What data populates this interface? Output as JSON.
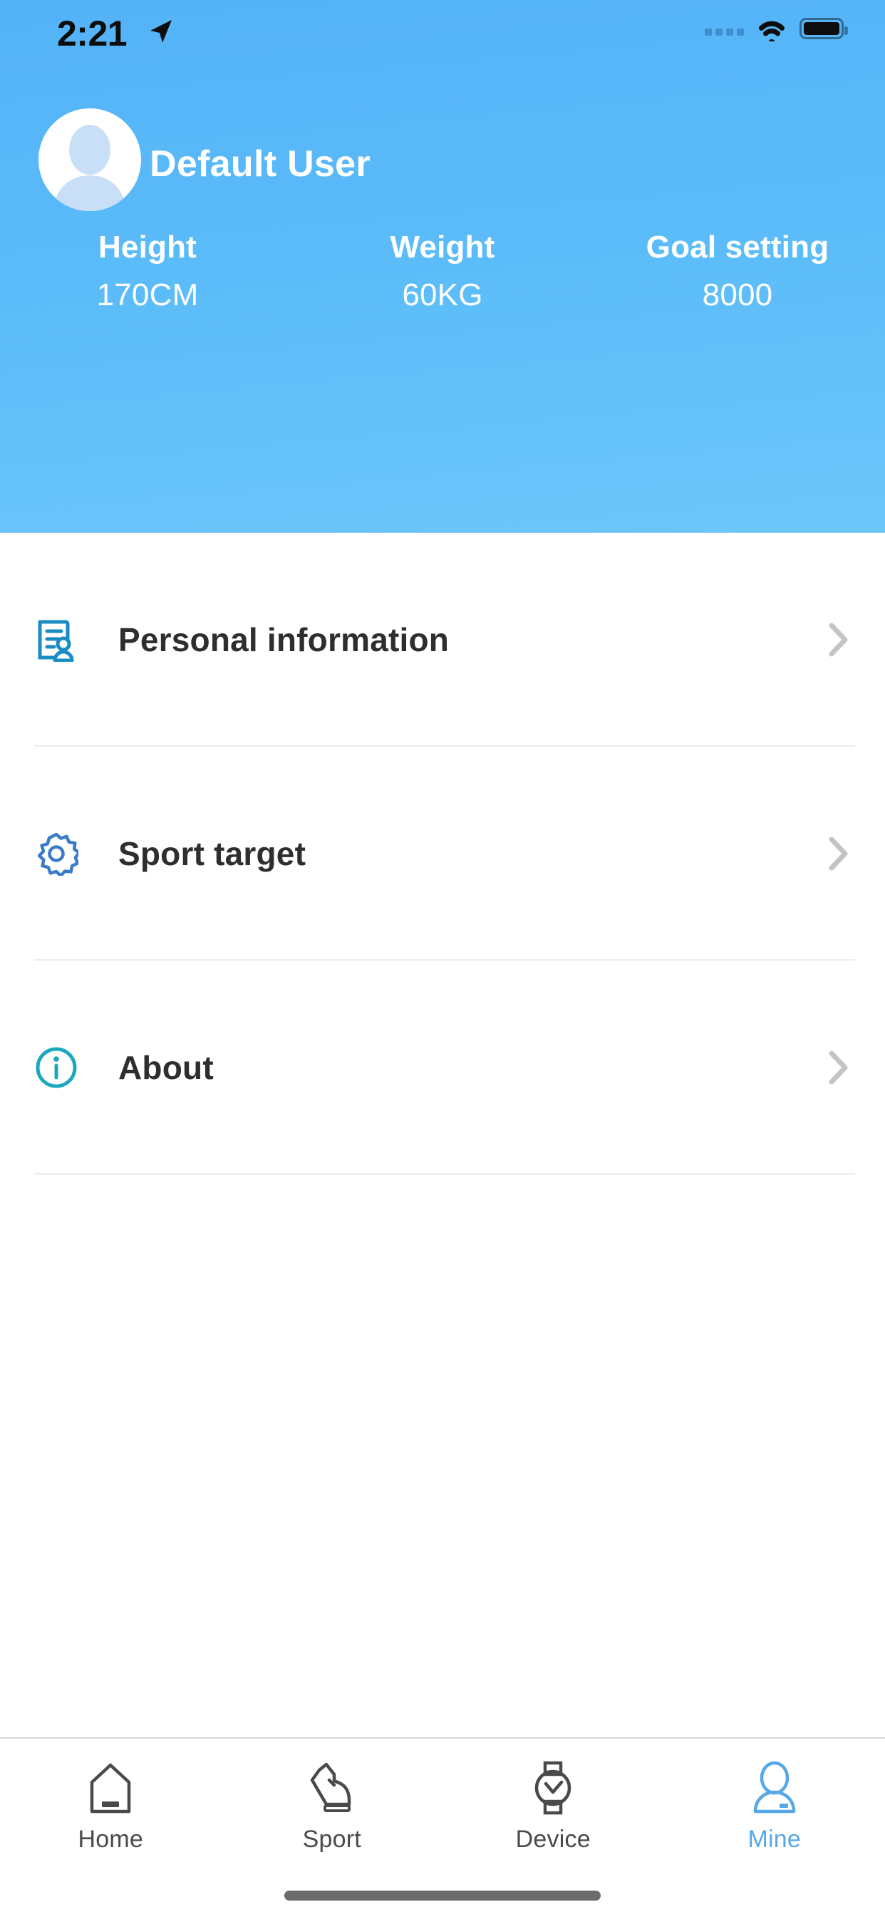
{
  "status_bar": {
    "time": "2:21",
    "location_icon": "location-arrow-icon",
    "signal_icon": "signal-dots-icon",
    "wifi_icon": "wifi-icon",
    "battery_icon": "battery-full-icon"
  },
  "header": {
    "avatar_icon": "default-avatar-icon",
    "username": "Default User",
    "accent_color": "#5bbcf9",
    "stats": [
      {
        "label": "Height",
        "value": "170CM"
      },
      {
        "label": "Weight",
        "value": "60KG"
      },
      {
        "label": "Goal setting",
        "value": "8000"
      }
    ]
  },
  "menu": {
    "items": [
      {
        "label": "Personal information",
        "icon": "document-person-icon",
        "icon_color": "#1a8cc4",
        "chevron_icon": "chevron-right-icon"
      },
      {
        "label": "Sport target",
        "icon": "gear-icon",
        "icon_color": "#3a7bc8",
        "chevron_icon": "chevron-right-icon"
      },
      {
        "label": "About",
        "icon": "info-circle-icon",
        "icon_color": "#1aa8bd",
        "chevron_icon": "chevron-right-icon"
      }
    ]
  },
  "tab_bar": {
    "active_color": "#56a8e8",
    "inactive_color": "#4a4a4a",
    "tabs": [
      {
        "label": "Home",
        "icon": "house-icon",
        "active": false
      },
      {
        "label": "Sport",
        "icon": "shoe-icon",
        "active": false
      },
      {
        "label": "Device",
        "icon": "watch-icon",
        "active": false
      },
      {
        "label": "Mine",
        "icon": "person-icon",
        "active": true
      }
    ],
    "home_indicator": "home-indicator-bar"
  }
}
